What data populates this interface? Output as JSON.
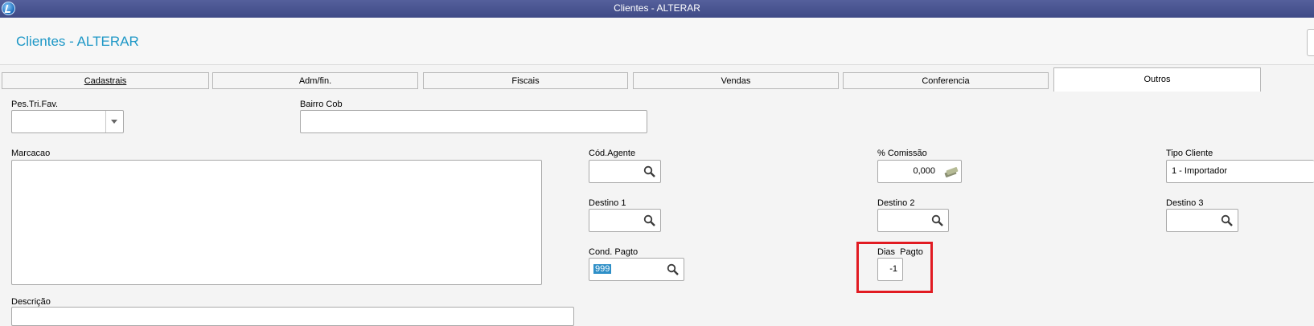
{
  "window": {
    "title": "Clientes - ALTERAR"
  },
  "page": {
    "title": "Clientes - ALTERAR"
  },
  "tabs": [
    {
      "label": "Cadastrais"
    },
    {
      "label": "Adm/fin."
    },
    {
      "label": "Fiscais"
    },
    {
      "label": "Vendas"
    },
    {
      "label": "Conferencia"
    },
    {
      "label": "Outros",
      "active": true
    }
  ],
  "form": {
    "pes_tri_fav": {
      "label": "Pes.Tri.Fav.",
      "value": ""
    },
    "bairro_cob": {
      "label": "Bairro Cob",
      "value": ""
    },
    "marcacao": {
      "label": "Marcacao",
      "value": ""
    },
    "cod_agente": {
      "label": "Cód.Agente",
      "value": ""
    },
    "comissao": {
      "label": "% Comissão",
      "value": "0,000"
    },
    "tipo_cliente": {
      "label": "Tipo Cliente",
      "value": "1 - Importador"
    },
    "destino1": {
      "label": "Destino 1",
      "value": ""
    },
    "destino2": {
      "label": "Destino 2",
      "value": ""
    },
    "destino3": {
      "label": "Destino 3",
      "value": ""
    },
    "cond_pagto": {
      "label": "Cond. Pagto",
      "value": "999"
    },
    "dias_pagto": {
      "label": "Dias  Pagto",
      "value": "-1"
    },
    "descricao": {
      "label": "Descrição"
    }
  },
  "colors": {
    "accent": "#1d97c6",
    "titlebar": "#3f4a86",
    "highlight": "#e11b22"
  },
  "icons": [
    "app-icon",
    "search-icon",
    "coin-icon",
    "chevron-down-icon"
  ]
}
